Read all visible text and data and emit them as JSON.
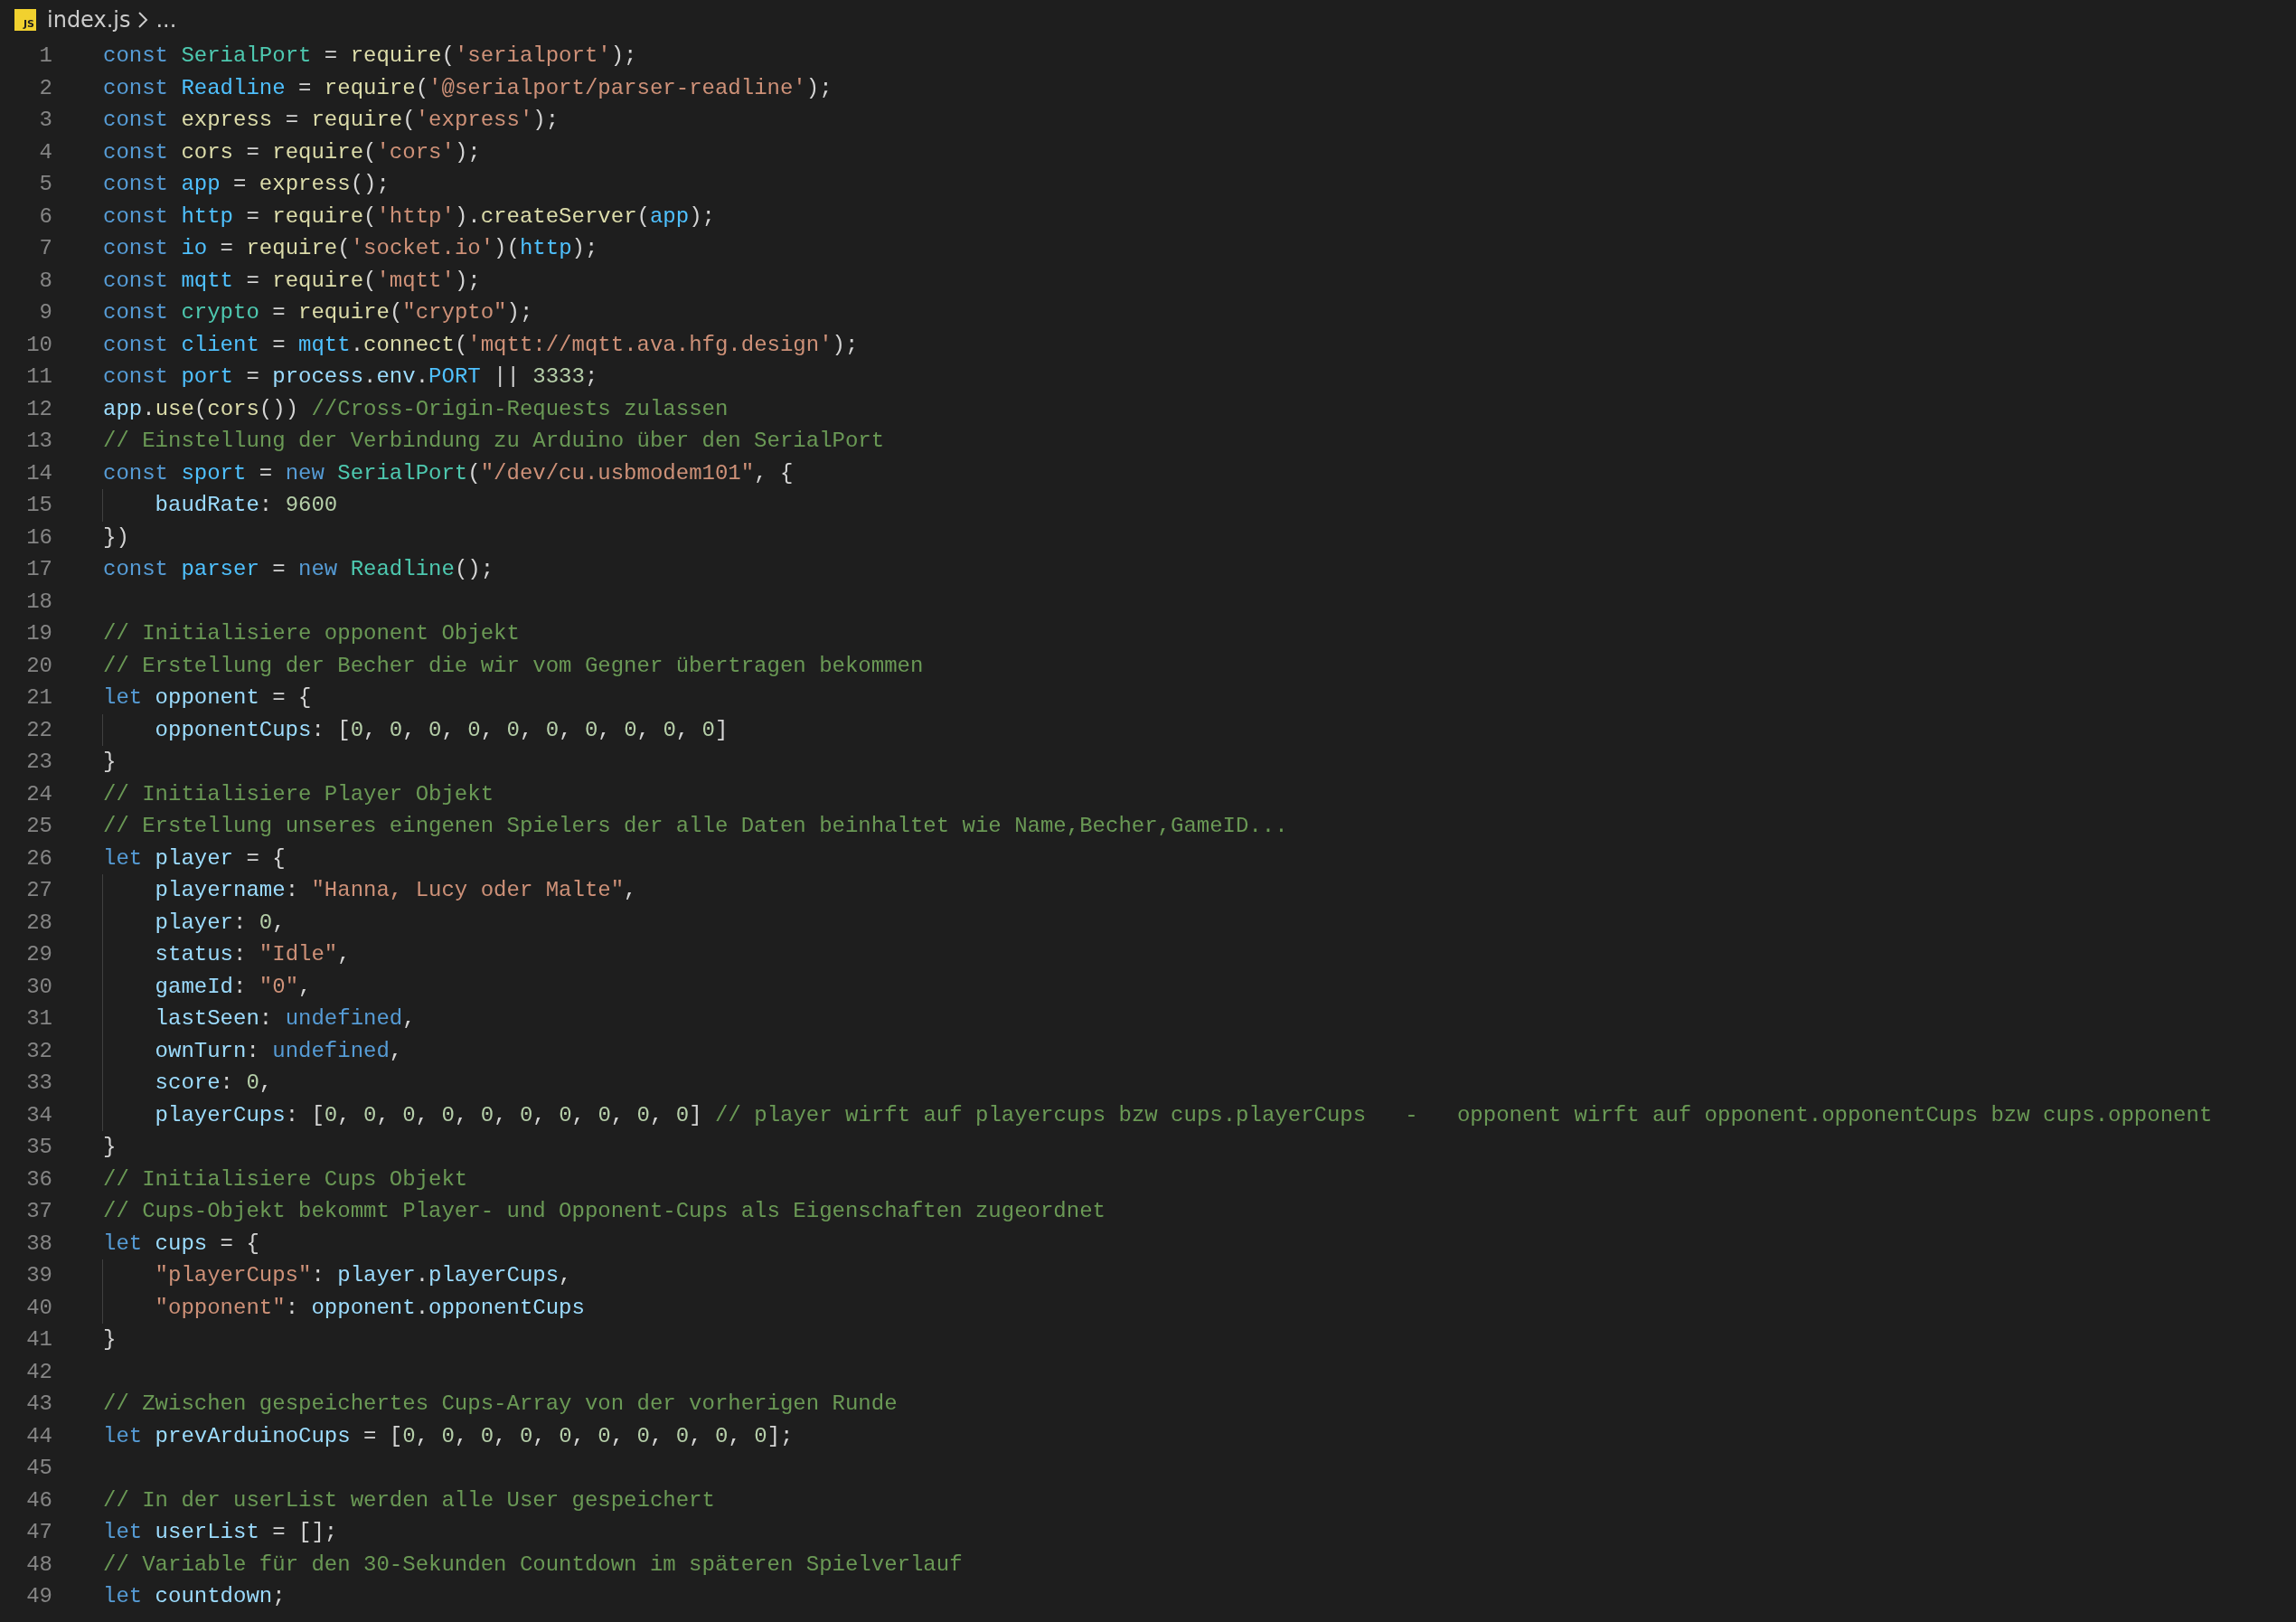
{
  "breadcrumb": {
    "file_badge": "JS",
    "file": "index.js",
    "more": "..."
  },
  "lines": [
    {
      "number": "1",
      "indented": false,
      "tokens": [
        {
          "kind": "kw",
          "text": "const"
        },
        {
          "kind": "cls",
          "text": "SerialPort"
        },
        {
          "kind": "plain",
          "text": " = "
        },
        {
          "kind": "fn",
          "text": "require"
        },
        {
          "kind": "plain",
          "text": "("
        },
        {
          "kind": "str",
          "text": "'serialport'"
        },
        {
          "kind": "plain",
          "text": ");"
        }
      ]
    },
    {
      "number": "2",
      "indented": false,
      "tokens": [
        {
          "kind": "kw",
          "text": "const"
        },
        {
          "kind": "const",
          "text": "Readline"
        },
        {
          "kind": "plain",
          "text": " = "
        },
        {
          "kind": "fn",
          "text": "require"
        },
        {
          "kind": "plain",
          "text": "("
        },
        {
          "kind": "str",
          "text": "'@serialport/parser-readline'"
        },
        {
          "kind": "plain",
          "text": ");"
        }
      ]
    },
    {
      "number": "3",
      "indented": false,
      "tokens": [
        {
          "kind": "kw",
          "text": "const"
        },
        {
          "kind": "fn",
          "text": "express"
        },
        {
          "kind": "plain",
          "text": " = "
        },
        {
          "kind": "fn",
          "text": "require"
        },
        {
          "kind": "plain",
          "text": "("
        },
        {
          "kind": "str",
          "text": "'express'"
        },
        {
          "kind": "plain",
          "text": ");"
        }
      ]
    },
    {
      "number": "4",
      "indented": false,
      "tokens": [
        {
          "kind": "kw",
          "text": "const"
        },
        {
          "kind": "fn",
          "text": "cors"
        },
        {
          "kind": "plain",
          "text": " = "
        },
        {
          "kind": "fn",
          "text": "require"
        },
        {
          "kind": "plain",
          "text": "("
        },
        {
          "kind": "str",
          "text": "'cors'"
        },
        {
          "kind": "plain",
          "text": ");"
        }
      ]
    },
    {
      "number": "5",
      "indented": false,
      "tokens": [
        {
          "kind": "kw",
          "text": "const"
        },
        {
          "kind": "const",
          "text": "app"
        },
        {
          "kind": "plain",
          "text": " = "
        },
        {
          "kind": "fn",
          "text": "express"
        },
        {
          "kind": "plain",
          "text": "();"
        }
      ]
    },
    {
      "number": "6",
      "indented": false,
      "tokens": [
        {
          "kind": "kw",
          "text": "const"
        },
        {
          "kind": "const",
          "text": "http"
        },
        {
          "kind": "plain",
          "text": " = "
        },
        {
          "kind": "fn",
          "text": "require"
        },
        {
          "kind": "plain",
          "text": "("
        },
        {
          "kind": "str",
          "text": "'http'"
        },
        {
          "kind": "plain",
          "text": ")."
        },
        {
          "kind": "fn",
          "text": "createServer"
        },
        {
          "kind": "plain",
          "text": "("
        },
        {
          "kind": "const",
          "text": "app"
        },
        {
          "kind": "plain",
          "text": ");"
        }
      ]
    },
    {
      "number": "7",
      "indented": false,
      "tokens": [
        {
          "kind": "kw",
          "text": "const"
        },
        {
          "kind": "const",
          "text": "io"
        },
        {
          "kind": "plain",
          "text": " = "
        },
        {
          "kind": "fn",
          "text": "require"
        },
        {
          "kind": "plain",
          "text": "("
        },
        {
          "kind": "str",
          "text": "'socket.io'"
        },
        {
          "kind": "plain",
          "text": ")("
        },
        {
          "kind": "const",
          "text": "http"
        },
        {
          "kind": "plain",
          "text": ");"
        }
      ]
    },
    {
      "number": "8",
      "indented": false,
      "tokens": [
        {
          "kind": "kw",
          "text": "const"
        },
        {
          "kind": "const",
          "text": "mqtt"
        },
        {
          "kind": "plain",
          "text": " = "
        },
        {
          "kind": "fn",
          "text": "require"
        },
        {
          "kind": "plain",
          "text": "("
        },
        {
          "kind": "str",
          "text": "'mqtt'"
        },
        {
          "kind": "plain",
          "text": ");"
        }
      ]
    },
    {
      "number": "9",
      "indented": false,
      "tokens": [
        {
          "kind": "kw",
          "text": "const"
        },
        {
          "kind": "cls",
          "text": "crypto"
        },
        {
          "kind": "plain",
          "text": " = "
        },
        {
          "kind": "fn",
          "text": "require"
        },
        {
          "kind": "plain",
          "text": "("
        },
        {
          "kind": "str",
          "text": "\"crypto\""
        },
        {
          "kind": "plain",
          "text": ");"
        }
      ]
    },
    {
      "number": "10",
      "indented": false,
      "tokens": [
        {
          "kind": "kw",
          "text": "const"
        },
        {
          "kind": "const",
          "text": "client"
        },
        {
          "kind": "plain",
          "text": " = "
        },
        {
          "kind": "const",
          "text": "mqtt"
        },
        {
          "kind": "plain",
          "text": "."
        },
        {
          "kind": "fn",
          "text": "connect"
        },
        {
          "kind": "plain",
          "text": "("
        },
        {
          "kind": "str",
          "text": "'mqtt://mqtt.ava.hfg.design'"
        },
        {
          "kind": "plain",
          "text": ");"
        }
      ]
    },
    {
      "number": "11",
      "indented": false,
      "tokens": [
        {
          "kind": "kw",
          "text": "const"
        },
        {
          "kind": "const",
          "text": "port"
        },
        {
          "kind": "plain",
          "text": " = "
        },
        {
          "kind": "var",
          "text": "process"
        },
        {
          "kind": "plain",
          "text": "."
        },
        {
          "kind": "var",
          "text": "env"
        },
        {
          "kind": "plain",
          "text": "."
        },
        {
          "kind": "const",
          "text": "PORT"
        },
        {
          "kind": "plain",
          "text": " || "
        },
        {
          "kind": "num",
          "text": "3333"
        },
        {
          "kind": "plain",
          "text": ";"
        }
      ]
    },
    {
      "number": "12",
      "indented": false,
      "tokens": [
        {
          "kind": "var",
          "text": "app"
        },
        {
          "kind": "plain",
          "text": "."
        },
        {
          "kind": "fn",
          "text": "use"
        },
        {
          "kind": "plain",
          "text": "("
        },
        {
          "kind": "fn",
          "text": "cors"
        },
        {
          "kind": "plain",
          "text": "())"
        },
        {
          "kind": "cmt",
          "text": "//Cross-Origin-Requests zulassen"
        }
      ]
    },
    {
      "number": "13",
      "indented": false,
      "tokens": [
        {
          "kind": "cmt",
          "text": "// Einstellung der Verbindung zu Arduino über den SerialPort"
        }
      ]
    },
    {
      "number": "14",
      "indented": false,
      "tokens": [
        {
          "kind": "kw",
          "text": "const"
        },
        {
          "kind": "const",
          "text": "sport"
        },
        {
          "kind": "plain",
          "text": " = "
        },
        {
          "kind": "kw",
          "text": "new"
        },
        {
          "kind": "cls",
          "text": "SerialPort"
        },
        {
          "kind": "plain",
          "text": "("
        },
        {
          "kind": "str",
          "text": "\"/dev/cu.usbmodem101\""
        },
        {
          "kind": "plain",
          "text": ", {"
        }
      ]
    },
    {
      "number": "15",
      "indented": true,
      "tokens": [
        {
          "kind": "var",
          "text": "baudRate"
        },
        {
          "kind": "plain",
          "text": ": "
        },
        {
          "kind": "num",
          "text": "9600"
        }
      ]
    },
    {
      "number": "16",
      "indented": false,
      "tokens": [
        {
          "kind": "plain",
          "text": "})"
        }
      ]
    },
    {
      "number": "17",
      "indented": false,
      "tokens": [
        {
          "kind": "kw",
          "text": "const"
        },
        {
          "kind": "const",
          "text": "parser"
        },
        {
          "kind": "plain",
          "text": " = "
        },
        {
          "kind": "kw",
          "text": "new"
        },
        {
          "kind": "cls",
          "text": "Readline"
        },
        {
          "kind": "plain",
          "text": "();"
        }
      ]
    },
    {
      "number": "18",
      "indented": false
    },
    {
      "number": "19",
      "indented": false,
      "tokens": [
        {
          "kind": "cmt",
          "text": "// Initialisiere opponent Objekt"
        }
      ]
    },
    {
      "number": "20",
      "indented": false,
      "tokens": [
        {
          "kind": "cmt",
          "text": "// Erstellung der Becher die wir vom Gegner übertragen bekommen"
        }
      ]
    },
    {
      "number": "21",
      "indented": false,
      "tokens": [
        {
          "kind": "kw",
          "text": "let"
        },
        {
          "kind": "var",
          "text": "opponent"
        },
        {
          "kind": "plain",
          "text": " = {"
        }
      ]
    },
    {
      "number": "22",
      "indented": true,
      "tokens": [
        {
          "kind": "var",
          "text": "opponentCups"
        },
        {
          "kind": "plain",
          "text": ": ["
        },
        {
          "kind": "num",
          "text": "0"
        },
        {
          "kind": "plain",
          "text": ", "
        },
        {
          "kind": "num",
          "text": "0"
        },
        {
          "kind": "plain",
          "text": ", "
        },
        {
          "kind": "num",
          "text": "0"
        },
        {
          "kind": "plain",
          "text": ", "
        },
        {
          "kind": "num",
          "text": "0"
        },
        {
          "kind": "plain",
          "text": ", "
        },
        {
          "kind": "num",
          "text": "0"
        },
        {
          "kind": "plain",
          "text": ", "
        },
        {
          "kind": "num",
          "text": "0"
        },
        {
          "kind": "plain",
          "text": ", "
        },
        {
          "kind": "num",
          "text": "0"
        },
        {
          "kind": "plain",
          "text": ", "
        },
        {
          "kind": "num",
          "text": "0"
        },
        {
          "kind": "plain",
          "text": ", "
        },
        {
          "kind": "num",
          "text": "0"
        },
        {
          "kind": "plain",
          "text": ", "
        },
        {
          "kind": "num",
          "text": "0"
        },
        {
          "kind": "plain",
          "text": "]"
        }
      ]
    },
    {
      "number": "23",
      "indented": false,
      "tokens": [
        {
          "kind": "plain",
          "text": "}"
        }
      ]
    },
    {
      "number": "24",
      "indented": false,
      "tokens": [
        {
          "kind": "cmt",
          "text": "// Initialisiere Player Objekt"
        }
      ]
    },
    {
      "number": "25",
      "indented": false,
      "tokens": [
        {
          "kind": "cmt",
          "text": "// Erstellung unseres eingenen Spielers der alle Daten beinhaltet wie Name,Becher,GameID..."
        }
      ]
    },
    {
      "number": "26",
      "indented": false,
      "tokens": [
        {
          "kind": "kw",
          "text": "let"
        },
        {
          "kind": "var",
          "text": "player"
        },
        {
          "kind": "plain",
          "text": " = {"
        }
      ]
    },
    {
      "number": "27",
      "indented": true,
      "tokens": [
        {
          "kind": "var",
          "text": "playername"
        },
        {
          "kind": "plain",
          "text": ": "
        },
        {
          "kind": "str",
          "text": "\"Hanna, Lucy oder Malte\""
        },
        {
          "kind": "plain",
          "text": ","
        }
      ]
    },
    {
      "number": "28",
      "indented": true,
      "tokens": [
        {
          "kind": "var",
          "text": "player"
        },
        {
          "kind": "plain",
          "text": ": "
        },
        {
          "kind": "num",
          "text": "0"
        },
        {
          "kind": "plain",
          "text": ","
        }
      ]
    },
    {
      "number": "29",
      "indented": true,
      "tokens": [
        {
          "kind": "var",
          "text": "status"
        },
        {
          "kind": "plain",
          "text": ": "
        },
        {
          "kind": "str",
          "text": "\"Idle\""
        },
        {
          "kind": "plain",
          "text": ","
        }
      ]
    },
    {
      "number": "30",
      "indented": true,
      "tokens": [
        {
          "kind": "var",
          "text": "gameId"
        },
        {
          "kind": "plain",
          "text": ": "
        },
        {
          "kind": "str",
          "text": "\"0\""
        },
        {
          "kind": "plain",
          "text": ","
        }
      ]
    },
    {
      "number": "31",
      "indented": true,
      "tokens": [
        {
          "kind": "var",
          "text": "lastSeen"
        },
        {
          "kind": "plain",
          "text": ": "
        },
        {
          "kind": "lit",
          "text": "undefined"
        },
        {
          "kind": "plain",
          "text": ","
        }
      ]
    },
    {
      "number": "32",
      "indented": true,
      "tokens": [
        {
          "kind": "var",
          "text": "ownTurn"
        },
        {
          "kind": "plain",
          "text": ": "
        },
        {
          "kind": "lit",
          "text": "undefined"
        },
        {
          "kind": "plain",
          "text": ","
        }
      ]
    },
    {
      "number": "33",
      "indented": true,
      "tokens": [
        {
          "kind": "var",
          "text": "score"
        },
        {
          "kind": "plain",
          "text": ": "
        },
        {
          "kind": "num",
          "text": "0"
        },
        {
          "kind": "plain",
          "text": ","
        }
      ]
    },
    {
      "number": "34",
      "indented": true,
      "tokens": [
        {
          "kind": "var",
          "text": "playerCups"
        },
        {
          "kind": "plain",
          "text": ": ["
        },
        {
          "kind": "num",
          "text": "0"
        },
        {
          "kind": "plain",
          "text": ", "
        },
        {
          "kind": "num",
          "text": "0"
        },
        {
          "kind": "plain",
          "text": ", "
        },
        {
          "kind": "num",
          "text": "0"
        },
        {
          "kind": "plain",
          "text": ", "
        },
        {
          "kind": "num",
          "text": "0"
        },
        {
          "kind": "plain",
          "text": ", "
        },
        {
          "kind": "num",
          "text": "0"
        },
        {
          "kind": "plain",
          "text": ", "
        },
        {
          "kind": "num",
          "text": "0"
        },
        {
          "kind": "plain",
          "text": ", "
        },
        {
          "kind": "num",
          "text": "0"
        },
        {
          "kind": "plain",
          "text": ", "
        },
        {
          "kind": "num",
          "text": "0"
        },
        {
          "kind": "plain",
          "text": ", "
        },
        {
          "kind": "num",
          "text": "0"
        },
        {
          "kind": "plain",
          "text": ", "
        },
        {
          "kind": "num",
          "text": "0"
        },
        {
          "kind": "plain",
          "text": "]"
        },
        {
          "kind": "cmt",
          "text": "// player wirft auf playercups bzw cups.playerCups   -   opponent wirft auf opponent.opponentCups bzw cups.opponent"
        }
      ]
    },
    {
      "number": "35",
      "indented": false,
      "tokens": [
        {
          "kind": "plain",
          "text": "}"
        }
      ]
    },
    {
      "number": "36",
      "indented": false,
      "tokens": [
        {
          "kind": "cmt",
          "text": "// Initialisiere Cups Objekt"
        }
      ]
    },
    {
      "number": "37",
      "indented": false,
      "tokens": [
        {
          "kind": "cmt",
          "text": "// Cups-Objekt bekommt Player- und Opponent-Cups als Eigenschaften zugeordnet"
        }
      ]
    },
    {
      "number": "38",
      "indented": false,
      "tokens": [
        {
          "kind": "kw",
          "text": "let"
        },
        {
          "kind": "var",
          "text": "cups"
        },
        {
          "kind": "plain",
          "text": " = {"
        }
      ]
    },
    {
      "number": "39",
      "indented": true,
      "tokens": [
        {
          "kind": "str",
          "text": "\"playerCups\""
        },
        {
          "kind": "plain",
          "text": ": "
        },
        {
          "kind": "var",
          "text": "player"
        },
        {
          "kind": "plain",
          "text": "."
        },
        {
          "kind": "var",
          "text": "playerCups"
        },
        {
          "kind": "plain",
          "text": ","
        }
      ]
    },
    {
      "number": "40",
      "indented": true,
      "tokens": [
        {
          "kind": "str",
          "text": "\"opponent\""
        },
        {
          "kind": "plain",
          "text": ": "
        },
        {
          "kind": "var",
          "text": "opponent"
        },
        {
          "kind": "plain",
          "text": "."
        },
        {
          "kind": "var",
          "text": "opponentCups"
        }
      ]
    },
    {
      "number": "41",
      "indented": false,
      "tokens": [
        {
          "kind": "plain",
          "text": "}"
        }
      ]
    },
    {
      "number": "42",
      "indented": false
    },
    {
      "number": "43",
      "indented": false,
      "tokens": [
        {
          "kind": "cmt",
          "text": "// Zwischen gespeichertes Cups-Array von der vorherigen Runde"
        }
      ]
    },
    {
      "number": "44",
      "indented": false,
      "tokens": [
        {
          "kind": "kw",
          "text": "let"
        },
        {
          "kind": "var",
          "text": "prevArduinoCups"
        },
        {
          "kind": "plain",
          "text": " = ["
        },
        {
          "kind": "num",
          "text": "0"
        },
        {
          "kind": "plain",
          "text": ", "
        },
        {
          "kind": "num",
          "text": "0"
        },
        {
          "kind": "plain",
          "text": ", "
        },
        {
          "kind": "num",
          "text": "0"
        },
        {
          "kind": "plain",
          "text": ", "
        },
        {
          "kind": "num",
          "text": "0"
        },
        {
          "kind": "plain",
          "text": ", "
        },
        {
          "kind": "num",
          "text": "0"
        },
        {
          "kind": "plain",
          "text": ", "
        },
        {
          "kind": "num",
          "text": "0"
        },
        {
          "kind": "plain",
          "text": ", "
        },
        {
          "kind": "num",
          "text": "0"
        },
        {
          "kind": "plain",
          "text": ", "
        },
        {
          "kind": "num",
          "text": "0"
        },
        {
          "kind": "plain",
          "text": ", "
        },
        {
          "kind": "num",
          "text": "0"
        },
        {
          "kind": "plain",
          "text": ", "
        },
        {
          "kind": "num",
          "text": "0"
        },
        {
          "kind": "plain",
          "text": "];"
        }
      ]
    },
    {
      "number": "45",
      "indented": false
    },
    {
      "number": "46",
      "indented": false,
      "tokens": [
        {
          "kind": "cmt",
          "text": "// In der userList werden alle User gespeichert"
        }
      ]
    },
    {
      "number": "47",
      "indented": false,
      "tokens": [
        {
          "kind": "kw",
          "text": "let"
        },
        {
          "kind": "var",
          "text": "userList"
        },
        {
          "kind": "plain",
          "text": " = [];"
        }
      ]
    },
    {
      "number": "48",
      "indented": false,
      "tokens": [
        {
          "kind": "cmt",
          "text": "// Variable für den 30-Sekunden Countdown im späteren Spielverlauf"
        }
      ]
    },
    {
      "number": "49",
      "indented": false,
      "tokens": [
        {
          "kind": "kw",
          "text": "let"
        },
        {
          "kind": "var",
          "text": "countdown"
        },
        {
          "kind": "plain",
          "text": ";"
        }
      ]
    }
  ]
}
